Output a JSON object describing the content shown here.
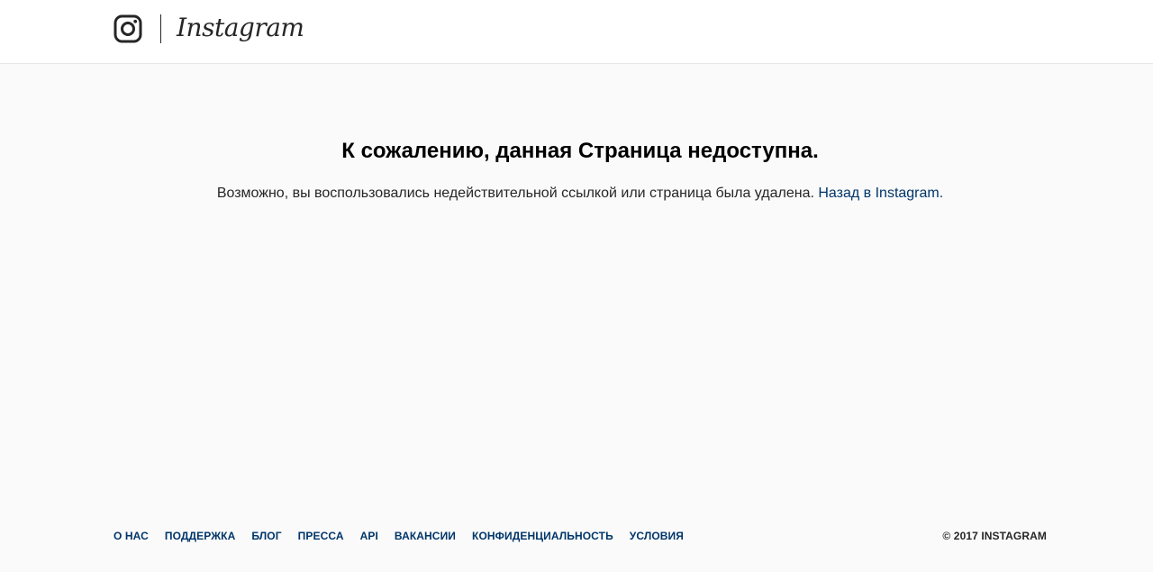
{
  "header": {
    "logo_icon": "instagram-camera-icon",
    "wordmark": "Instagram"
  },
  "main": {
    "title": "К сожалению, данная Страница недоступна.",
    "message": "Возможно, вы воспользовались недействительной ссылкой или страница была удалена.",
    "back_link": "Назад в Instagram."
  },
  "footer": {
    "links": [
      {
        "label": "О НАС"
      },
      {
        "label": "ПОДДЕРЖКА"
      },
      {
        "label": "БЛОГ"
      },
      {
        "label": "ПРЕССА"
      },
      {
        "label": "API"
      },
      {
        "label": "ВАКАНСИИ"
      },
      {
        "label": "КОНФИДЕНЦИАЛЬНОСТЬ"
      },
      {
        "label": "УСЛОВИЯ"
      }
    ],
    "copyright": "© 2017 INSTAGRAM"
  },
  "colors": {
    "background": "#fafafa",
    "header_bg": "#ffffff",
    "link": "#003569",
    "text": "#262626",
    "title": "#000000"
  }
}
